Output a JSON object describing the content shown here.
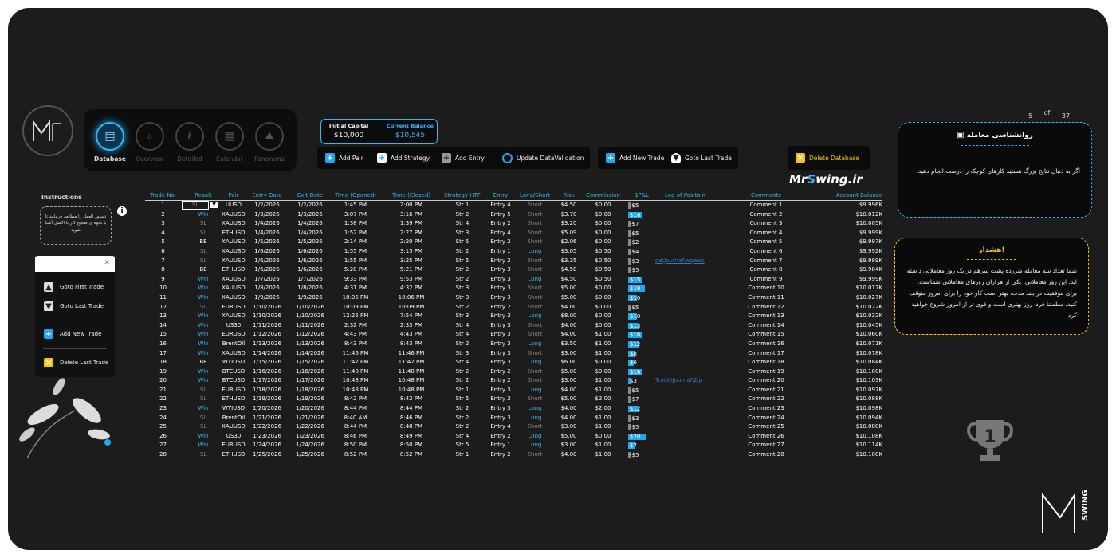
{
  "brand": {
    "logo_text": "MSWING",
    "corner_logo_text": "SWING",
    "site_pre": "Mr",
    "site_s": "S",
    "site_post": "wing.ir"
  },
  "nav": [
    {
      "label": "Database",
      "icon": "database-icon",
      "active": true
    },
    {
      "label": "Overview",
      "icon": "overview-icon",
      "active": false
    },
    {
      "label": "Detailed",
      "icon": "detailed-icon",
      "active": false
    },
    {
      "label": "Calendar",
      "icon": "calendar-icon",
      "active": false
    },
    {
      "label": "Panorama",
      "icon": "panorama-icon",
      "active": false
    }
  ],
  "capital": {
    "initial_label": "Initial Capital",
    "initial_value": "$10,000",
    "current_label": "Current Balance",
    "current_value": "$10,545"
  },
  "toolbar1": [
    {
      "label": "Add Pair",
      "icon": "add-icon"
    },
    {
      "label": "Add Strategy",
      "icon": "add-icon"
    },
    {
      "label": "Add Entry",
      "icon": "add-icon"
    },
    {
      "label": "Update DataValidation",
      "icon": "refresh-icon"
    }
  ],
  "toolbar2": [
    {
      "label": "Add New Trade",
      "icon": "add-icon"
    },
    {
      "label": "Goto Last Trade",
      "icon": "arrow-down-icon"
    }
  ],
  "delete_db": {
    "label": "Delete Database",
    "icon": "x-icon"
  },
  "instructions": {
    "title": "Instructions",
    "bubble_text": "دستور العمل را مطالعه فرمایید تا با نحوه ی صحیح کار با اکسل آشنا شوید"
  },
  "quick_panel": [
    {
      "label": "Goto First Trade",
      "icon": "arrow-up-icon"
    },
    {
      "label": "Goto Last Trade",
      "icon": "arrow-down-icon"
    },
    {
      "label": "Add New Trade",
      "icon": "add-icon"
    },
    {
      "label": "Delete Last Trade",
      "icon": "x-icon"
    }
  ],
  "pager": {
    "current": "5",
    "of": "of",
    "total": "37"
  },
  "psychology": {
    "title": "روانشناسی معامله",
    "body": "اگر به دنبال نتایج بزرگ هستید کارهای کوچک را درست انجام دهید."
  },
  "warning": {
    "title": "هشدار!",
    "body": "شما تعداد سه معامله ضررده پشت سرهم در یک روز معاملاتی داشته اید. این روز معاملاتی، یکی از هزاران روزهای معاملاتی شماست. برای موفقیت در بلند مدت، بهتر است کار خود را برای امروز متوقف کنید. مطمئنا فردا روز بهتری است و قوی تر از امروز شروع خواهید کرد"
  },
  "trophy": {
    "number": "1"
  },
  "table": {
    "headers": [
      "Trade No.",
      "Result",
      "Pair",
      "Entry Date",
      "Exit Date",
      "Time (Opened)",
      "Time (Closed)",
      "Strategy HTF",
      "Entry",
      "Long/Short",
      "Risk",
      "Commission",
      "$P&L",
      "Log of Positoin",
      "Comments",
      "Account Balance"
    ],
    "rows": [
      [
        "1",
        "SL",
        "UUSD",
        "1/2/2026",
        "1/2/2026",
        "1:45 PM",
        "2:00 PM",
        "Str 1",
        "Entry 4",
        "Short",
        "$4.50",
        "$0.00",
        "-$5",
        "",
        "Comment 1",
        "$9.996K"
      ],
      [
        "2",
        "Win",
        "XAUUSD",
        "1/3/2026",
        "1/3/2026",
        "3:07 PM",
        "3:16 PM",
        "Str 2",
        "Entry 5",
        "Short",
        "$3.70",
        "$0.00",
        "$16",
        "",
        "Comment 2",
        "$10.012K"
      ],
      [
        "3",
        "SL",
        "XAUUSD",
        "1/4/2026",
        "1/4/2026",
        "1:38 PM",
        "1:39 PM",
        "Str 4",
        "Entry 2",
        "Short",
        "$3.20",
        "$0.00",
        "-$7",
        "",
        "Comment 3",
        "$10.005K"
      ],
      [
        "4",
        "SL",
        "ETHUSD",
        "1/4/2026",
        "1/4/2026",
        "1:52 PM",
        "2:27 PM",
        "Str 3",
        "Entry 4",
        "Short",
        "$5.09",
        "$0.00",
        "-$5",
        "",
        "Comment 4",
        "$9.999K"
      ],
      [
        "5",
        "BE",
        "XAUUSD",
        "1/5/2026",
        "1/5/2026",
        "2:14 PM",
        "2:20 PM",
        "Str 5",
        "Entry 2",
        "Short",
        "$2.06",
        "$0.00",
        "-$2",
        "",
        "Comment 5",
        "$9.997K"
      ],
      [
        "6",
        "SL",
        "XAUUSD",
        "1/6/2026",
        "1/6/2026",
        "1:55 PM",
        "3:15 PM",
        "Str 2",
        "Entry 1",
        "Long",
        "$3.05",
        "$0.50",
        "-$4",
        "",
        "Comment 6",
        "$9.992K"
      ],
      [
        "7",
        "SL",
        "XAUUSD",
        "1/6/2026",
        "1/6/2026",
        "1:55 PM",
        "3:25 PM",
        "Str 5",
        "Entry 2",
        "Short",
        "$3.35",
        "$0.50",
        "-$3",
        "de\\Journal\\wqewc",
        "Comment 7",
        "$9.989K"
      ],
      [
        "8",
        "BE",
        "ETHUSD",
        "1/6/2026",
        "1/6/2026",
        "5:20 PM",
        "5:21 PM",
        "Str 2",
        "Entry 3",
        "Short",
        "$4.58",
        "$0.50",
        "-$5",
        "",
        "Comment 8",
        "$9.984K"
      ],
      [
        "9",
        "Win",
        "XAUUSD",
        "1/7/2026",
        "1/7/2026",
        "9:33 PM",
        "9:53 PM",
        "Str 2",
        "Entry 3",
        "Long",
        "$4.50",
        "$0.50",
        "$15",
        "",
        "Comment 9",
        "$9.999K"
      ],
      [
        "10",
        "Win",
        "XAUUSD",
        "1/8/2026",
        "1/8/2026",
        "4:31 PM",
        "4:32 PM",
        "Str 3",
        "Entry 3",
        "Short",
        "$5.00",
        "$0.00",
        "$19",
        "",
        "Comment 10",
        "$10.017K"
      ],
      [
        "11",
        "Win",
        "XAUUSD",
        "1/9/2026",
        "1/9/2026",
        "10:05 PM",
        "10:06 PM",
        "Str 3",
        "Entry 3",
        "Short",
        "$5.00",
        "$0.00",
        "$10",
        "",
        "Comment 11",
        "$10.027K"
      ],
      [
        "12",
        "SL",
        "EURUSD",
        "1/10/2026",
        "1/10/2026",
        "10:09 PM",
        "10:09 PM",
        "Str 2",
        "Entry 2",
        "Short",
        "$4.00",
        "$0.00",
        "-$5",
        "",
        "Comment 12",
        "$10.022K"
      ],
      [
        "13",
        "Win",
        "XAUUSD",
        "1/10/2026",
        "1/10/2026",
        "12:25 PM",
        "7:54 PM",
        "Str 3",
        "Entry 3",
        "Long",
        "$8.00",
        "$0.00",
        "$10",
        "",
        "Comment 13",
        "$10.032K"
      ],
      [
        "14",
        "Win",
        "US30",
        "1/11/2026",
        "1/11/2026",
        "2:32 PM",
        "2:33 PM",
        "Str 4",
        "Entry 3",
        "Short",
        "$4.00",
        "$0.00",
        "$13",
        "",
        "Comment 14",
        "$10.045K"
      ],
      [
        "15",
        "Win",
        "EURUSD",
        "1/12/2026",
        "1/12/2026",
        "4:43 PM",
        "4:43 PM",
        "Str 4",
        "Entry 3",
        "Short",
        "$4.00",
        "$1.00",
        "$16",
        "",
        "Comment 15",
        "$10.060K"
      ],
      [
        "16",
        "Win",
        "BrentOil",
        "1/13/2026",
        "1/13/2026",
        "8:43 PM",
        "8:43 PM",
        "Str 2",
        "Entry 3",
        "Long",
        "$3.50",
        "$1.00",
        "$12",
        "",
        "Comment 16",
        "$10.071K"
      ],
      [
        "17",
        "Win",
        "XAUUSD",
        "1/14/2026",
        "1/14/2026",
        "11:46 PM",
        "11:46 PM",
        "Str 3",
        "Entry 3",
        "Short",
        "$3.00",
        "$1.00",
        "$8",
        "",
        "Comment 17",
        "$10.078K"
      ],
      [
        "18",
        "BE",
        "WTIUSD",
        "1/15/2026",
        "1/15/2026",
        "11:47 PM",
        "11:47 PM",
        "Str 4",
        "Entry 3",
        "Long",
        "$6.00",
        "$0.00",
        "$6",
        "",
        "Comment 18",
        "$10.084K"
      ],
      [
        "19",
        "Win",
        "BTCUSD",
        "1/16/2026",
        "1/16/2026",
        "11:48 PM",
        "11:48 PM",
        "Str 2",
        "Entry 2",
        "Short",
        "$5.00",
        "$0.00",
        "$16",
        "",
        "Comment 19",
        "$10.100K"
      ],
      [
        "20",
        "Win",
        "BTCUSD",
        "1/17/2026",
        "1/17/2026",
        "10:48 PM",
        "10:48 PM",
        "Str 2",
        "Entry 2",
        "Short",
        "$3.00",
        "$1.00",
        "$3",
        "Trade\\Journal\\2.p",
        "Comment 20",
        "$10.103K"
      ],
      [
        "21",
        "SL",
        "EURUSD",
        "1/18/2026",
        "1/18/2026",
        "10:48 PM",
        "10:48 PM",
        "Str 1",
        "Entry 3",
        "Long",
        "$4.00",
        "$1.00",
        "-$5",
        "",
        "Comment 21",
        "$10.097K"
      ],
      [
        "22",
        "SL",
        "ETHUSD",
        "1/19/2026",
        "1/19/2026",
        "8:42 PM",
        "8:42 PM",
        "Str 5",
        "Entry 3",
        "Short",
        "$5.00",
        "$2.00",
        "-$7",
        "",
        "Comment 22",
        "$10.088K"
      ],
      [
        "23",
        "Win",
        "WTIUSD",
        "1/20/2026",
        "1/20/2026",
        "8:44 PM",
        "8:44 PM",
        "Str 2",
        "Entry 3",
        "Long",
        "$4.00",
        "$2.00",
        "$12",
        "",
        "Comment 23",
        "$10.098K"
      ],
      [
        "24",
        "SL",
        "BrentOil",
        "1/21/2026",
        "1/21/2026",
        "8:40 AM",
        "8:46 PM",
        "Str 2",
        "Entry 3",
        "Long",
        "$4.00",
        "$1.00",
        "-$3",
        "",
        "Comment 24",
        "$10.094K"
      ],
      [
        "25",
        "SL",
        "XAUUSD",
        "1/22/2026",
        "1/22/2026",
        "8:44 PM",
        "8:48 PM",
        "Str 2",
        "Entry 4",
        "Short",
        "$3.00",
        "$1.00",
        "-$5",
        "",
        "Comment 25",
        "$10.088K"
      ],
      [
        "26",
        "Win",
        "US30",
        "1/23/2026",
        "1/23/2026",
        "8:46 PM",
        "8:49 PM",
        "Str 4",
        "Entry 2",
        "Long",
        "$5.00",
        "$0.00",
        "$20",
        "",
        "Comment 26",
        "$10.108K"
      ],
      [
        "27",
        "Win",
        "EURUSD",
        "1/24/2026",
        "1/24/2026",
        "8:50 PM",
        "8:50 PM",
        "Str 5",
        "Entry 1",
        "Long",
        "$3.00",
        "$1.00",
        "$7",
        "",
        "Comment 27",
        "$10.114K"
      ],
      [
        "28",
        "SL",
        "ETHUSD",
        "1/25/2026",
        "1/25/2026",
        "8:52 PM",
        "8:52 PM",
        "Str 1",
        "Entry 2",
        "Short",
        "$4.00",
        "$1.00",
        "-$5",
        "",
        "Comment 28",
        "$10.108K"
      ]
    ]
  },
  "colors": {
    "accent": "#1ea8ee",
    "warning": "#f2c318",
    "background": "#1c1c1c",
    "loss": "#888888"
  }
}
